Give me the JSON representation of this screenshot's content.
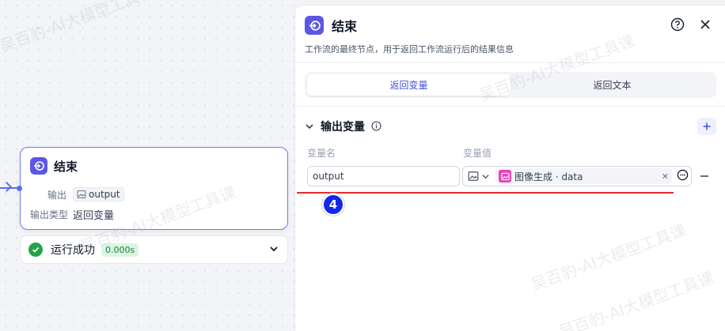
{
  "canvas": {
    "node": {
      "title": "结束",
      "output_label": "输出",
      "output_var": "output",
      "output_type_label": "输出类型",
      "output_type_value": "返回变量"
    },
    "run": {
      "status": "运行成功",
      "time": "0.000s"
    }
  },
  "panel": {
    "title": "结束",
    "description": "工作流的最终节点，用于返回工作流运行后的结果信息",
    "tabs": [
      {
        "label": "返回变量",
        "active": true
      },
      {
        "label": "返回文本",
        "active": false
      }
    ],
    "section": {
      "title": "输出变量",
      "col_name": "变量名",
      "col_value": "变量值",
      "row": {
        "name": "output",
        "ref": "图像生成 · data"
      }
    },
    "annotation_badge": "4"
  },
  "watermark": "吴百豹-AI大模型工具课",
  "colors": {
    "accent": "#5b57e6",
    "success": "#22a447",
    "annotation_line": "#e52b2b",
    "badge": "#1227e8",
    "ref_icon": "#e245b9"
  }
}
